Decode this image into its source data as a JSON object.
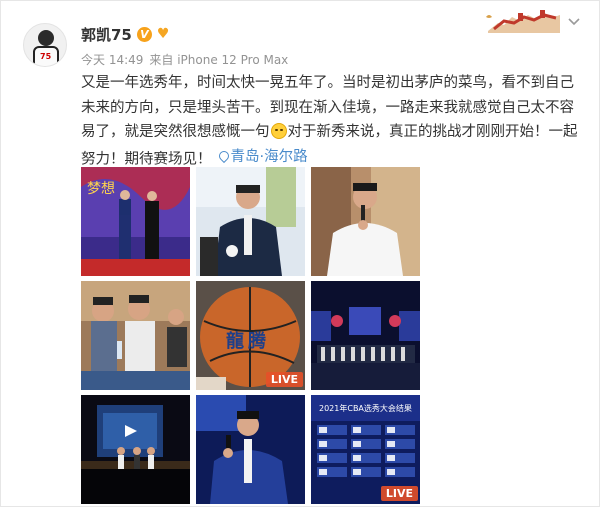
{
  "post": {
    "author": "郭凯75",
    "vip_badge": "V",
    "time": "今天 14:49",
    "source": "来自 iPhone 12 Pro Max",
    "text_before_emoji": "又是一年选秀年，时间太快一晃五年了。当时是初出茅庐的菜鸟，看不到自己未来的方向，只是埋头苦干。到现在渐入佳境，一路走来我就感觉自己太不容易了，就是突然很想感慨一句",
    "text_after_emoji": "对于新秀来说，真正的挑战才刚刚开始！一起努力！期待赛场见！",
    "emoji_icon": "tearful-face-icon",
    "location": "青岛·海尔路"
  },
  "photos": [
    {
      "name": "photo-1",
      "desc_icon": "photo-stage-two-men",
      "live": ""
    },
    {
      "name": "photo-2",
      "desc_icon": "photo-man-suit",
      "live": ""
    },
    {
      "name": "photo-3",
      "desc_icon": "photo-man-speaking",
      "live": ""
    },
    {
      "name": "photo-4",
      "desc_icon": "photo-seated-men",
      "live": ""
    },
    {
      "name": "photo-5",
      "desc_icon": "photo-basketball",
      "live": "LIVE"
    },
    {
      "name": "photo-6",
      "desc_icon": "photo-stage-group",
      "live": ""
    },
    {
      "name": "photo-7",
      "desc_icon": "photo-stage-screen",
      "live": ""
    },
    {
      "name": "photo-8",
      "desc_icon": "photo-man-microphone",
      "live": ""
    },
    {
      "name": "photo-9",
      "desc_icon": "photo-draft-board",
      "live": "LIVE"
    }
  ],
  "colors": {
    "link": "#4a8bcb",
    "meta": "#939393",
    "live_badge": "#e65028",
    "vip": "#f7a21b"
  }
}
